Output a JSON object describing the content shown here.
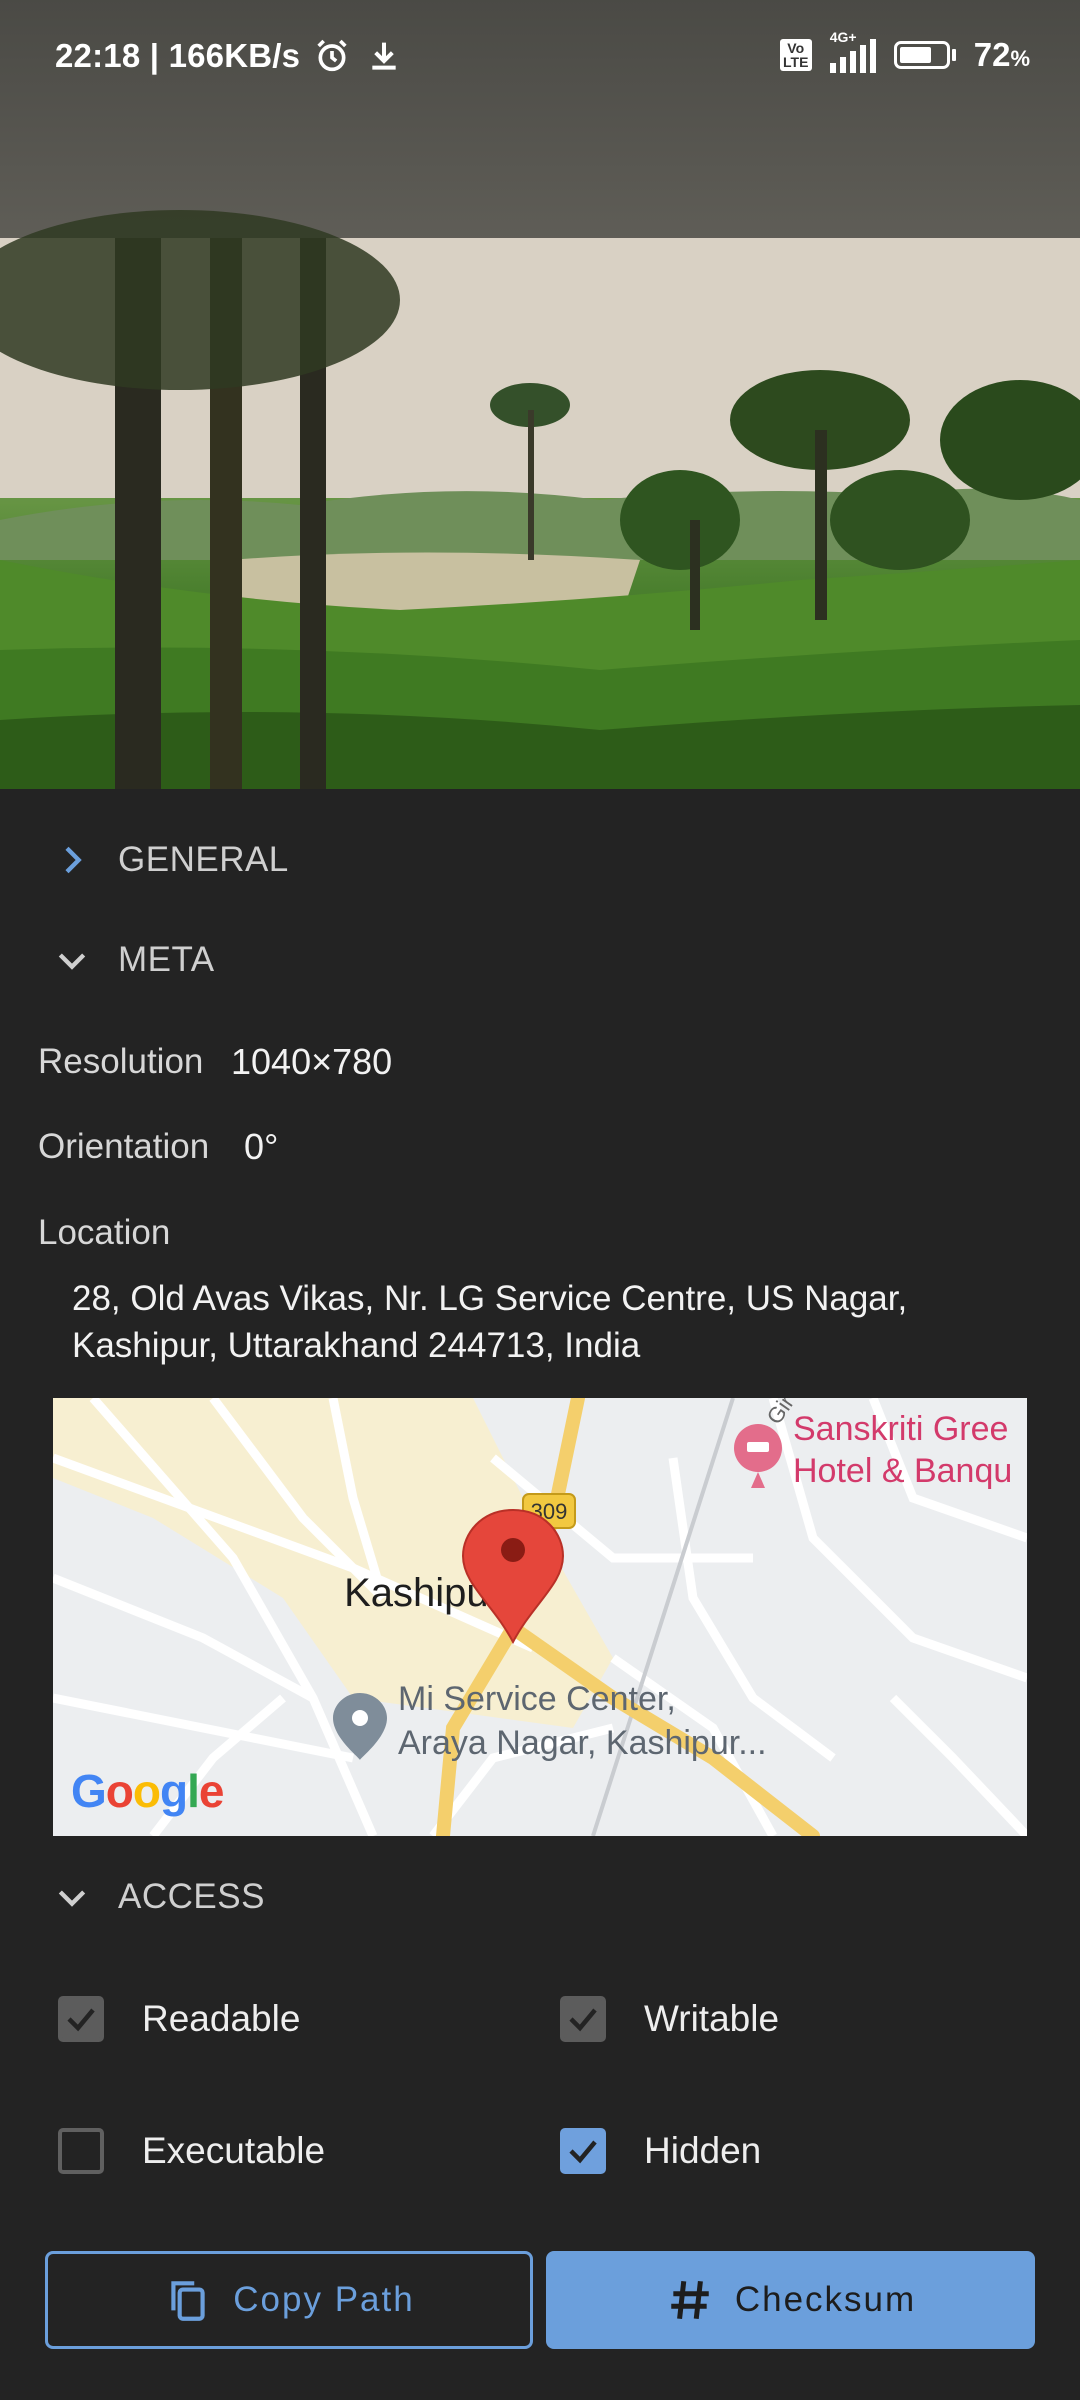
{
  "status_bar": {
    "time_speed": "22:18 | 166KB/s",
    "network": "4G+",
    "volte": "Vo LTE",
    "battery": "72",
    "battery_unit": "%"
  },
  "sections": {
    "general": "GENERAL",
    "meta": "META",
    "access": "ACCESS"
  },
  "meta": {
    "resolution_label": "Resolution",
    "resolution_value": "1040×780",
    "orientation_label": "Orientation",
    "orientation_value": "0°",
    "location_label": "Location",
    "address_line1": "28, Old Avas Vikas, Nr. LG Service Centre, US Nagar,",
    "address_line2": "Kashipur, Uttarakhand 244713, India"
  },
  "map": {
    "city": "Kashipur",
    "road_badge": "309",
    "poi_hotel_line1": "Sanskriti Gree",
    "poi_hotel_line2": "Hotel & Banqu",
    "poi_service_line1": "Mi Service Center,",
    "poi_service_line2": "Araya Nagar, Kashipur...",
    "road_label": "Gir",
    "logo": "Google"
  },
  "access": {
    "readable": {
      "label": "Readable",
      "checked": true
    },
    "writable": {
      "label": "Writable",
      "checked": true
    },
    "executable": {
      "label": "Executable",
      "checked": false
    },
    "hidden": {
      "label": "Hidden",
      "checked": true
    }
  },
  "buttons": {
    "copy_path": "Copy Path",
    "checksum": "Checksum"
  },
  "colors": {
    "accent": "#6b9fdc",
    "background": "#232323"
  }
}
